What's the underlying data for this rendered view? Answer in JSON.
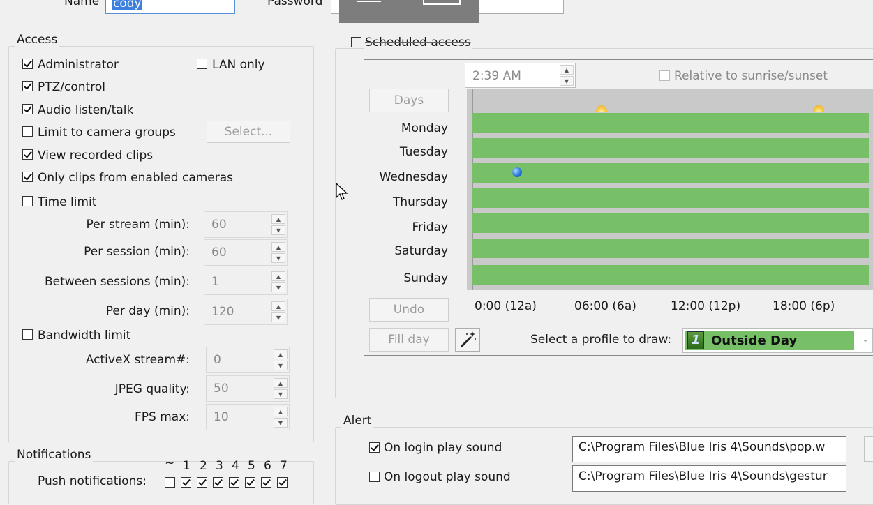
{
  "top": {
    "name_label": "Name",
    "name_value": "cody",
    "password_label": "Password"
  },
  "access": {
    "title": "Access",
    "administrator": "Administrator",
    "lan_only": "LAN only",
    "ptz_control": "PTZ/control",
    "audio": "Audio listen/talk",
    "limit_groups": "Limit to camera groups",
    "select_button": "Select...",
    "view_clips": "View recorded clips",
    "only_enabled": "Only clips from enabled cameras",
    "time_limit": "Time limit",
    "per_stream_label": "Per stream (min):",
    "per_stream_value": "60",
    "per_session_label": "Per session (min):",
    "per_session_value": "60",
    "between_label": "Between sessions (min):",
    "between_value": "1",
    "per_day_label": "Per day (min):",
    "per_day_value": "120",
    "bandwidth_limit": "Bandwidth limit",
    "activex_label": "ActiveX stream#:",
    "activex_value": "0",
    "jpeg_label": "JPEG quality:",
    "jpeg_value": "50",
    "fps_label": "FPS max:",
    "fps_value": "10"
  },
  "schedule": {
    "title": "Scheduled access",
    "time_value": "2:39 AM",
    "relative_label": "Relative to sunrise/sunset",
    "days_button": "Days",
    "undo_button": "Undo",
    "fill_day_button": "Fill day",
    "days": [
      "Monday",
      "Tuesday",
      "Wednesday",
      "Thursday",
      "Friday",
      "Saturday",
      "Sunday"
    ],
    "time_axis": [
      "0:00 (12a)",
      "06:00 (6a)",
      "12:00 (12p)",
      "18:00 (6p)"
    ],
    "profile_label": "Select a profile to draw:",
    "profile_number": "1",
    "profile_value": "Outside Day",
    "bar_color": "#77c067"
  },
  "notifications": {
    "title": "Notifications",
    "push_label": "Push notifications:",
    "profile_headers": [
      "~",
      "1",
      "2",
      "3",
      "4",
      "5",
      "6",
      "7"
    ]
  },
  "alert": {
    "title": "Alert",
    "login_label": "On login play sound",
    "login_path": "C:\\Program Files\\Blue Iris 4\\Sounds\\pop.w",
    "logout_label": "On logout play sound",
    "logout_path": "C:\\Program Files\\Blue Iris 4\\Sounds\\gestur"
  }
}
